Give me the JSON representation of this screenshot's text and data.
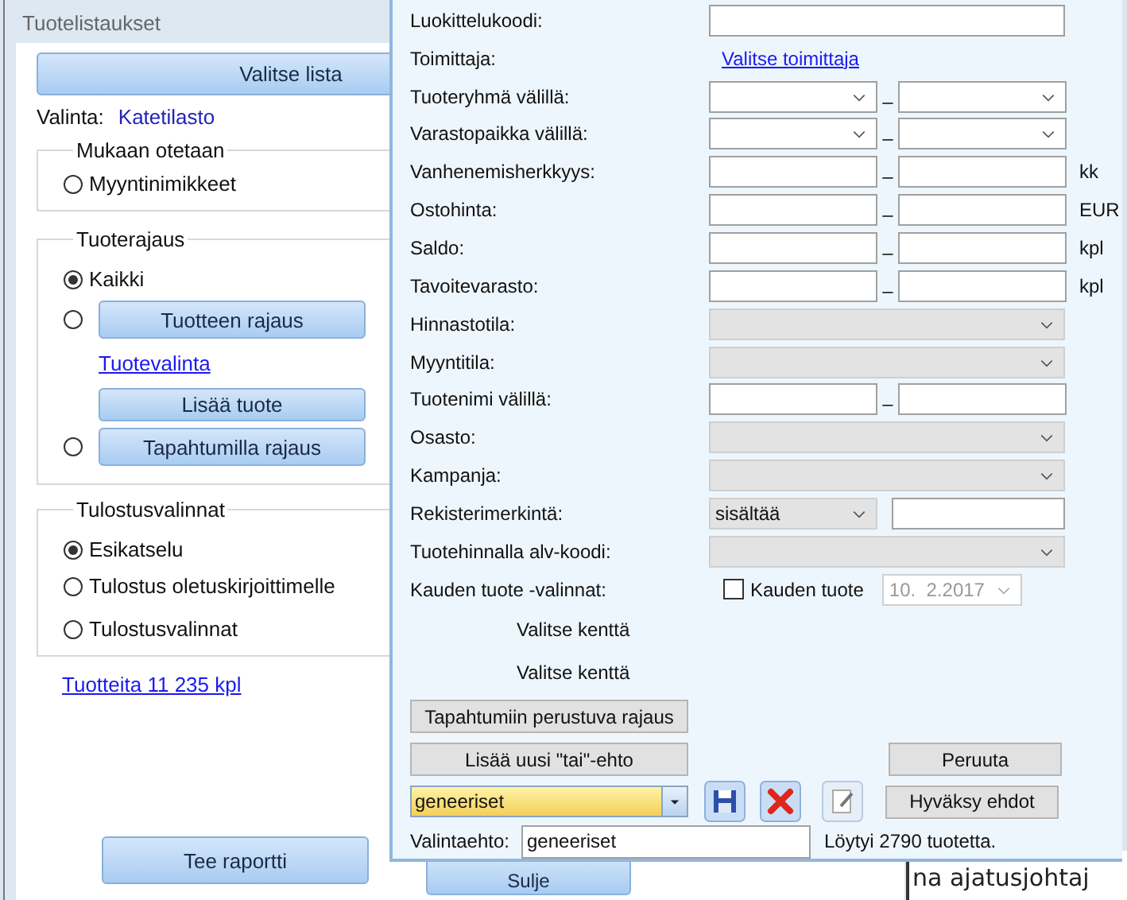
{
  "left_window": {
    "title": "Tuotelistaukset",
    "choose_list_button": "Valitse lista",
    "selection_label": "Valinta:",
    "selection_value": "Katetilasto",
    "groups": [
      {
        "title": "Mukaan otetaan",
        "items": [
          {
            "kind": "radio",
            "label": "Myyntinimikkeet",
            "selected": false
          }
        ]
      },
      {
        "title": "Tuoterajaus",
        "items": [
          {
            "kind": "radio",
            "label": "Kaikki",
            "selected": true
          },
          {
            "kind": "radio_button",
            "label": "Tuotteen rajaus",
            "selected": false
          },
          {
            "kind": "link",
            "label": "Tuotevalinta"
          },
          {
            "kind": "button",
            "label": "Lisää tuote"
          },
          {
            "kind": "radio_button",
            "label": "Tapahtumilla rajaus",
            "selected": false
          }
        ]
      },
      {
        "title": "Tulostusvalinnat",
        "items": [
          {
            "kind": "radio",
            "label": "Esikatselu",
            "selected": true
          },
          {
            "kind": "radio",
            "label": "Tulostus oletuskirjoittimelle",
            "selected": false
          },
          {
            "kind": "radio",
            "label": "Tulostusvalinnat",
            "selected": false
          }
        ]
      }
    ],
    "count_link": "Tuotteita 11 235 kpl",
    "report_button": "Tee raportti",
    "close_button": "Sulje"
  },
  "background_text": "na ajatusjohtaj",
  "dialog": {
    "rows": [
      {
        "label": "Luokittelukoodi:",
        "kind": "text"
      },
      {
        "label": "Toimittaja:",
        "kind": "link",
        "link": "Valitse toimittaja"
      },
      {
        "label": "Tuoteryhmä välillä:",
        "kind": "combo_range",
        "separator": "–"
      },
      {
        "label": "Varastopaikka välillä:",
        "kind": "combo_range",
        "separator": "–"
      },
      {
        "label": "Vanhenemisherkkyys:",
        "kind": "text_range",
        "separator": "–",
        "unit": "kk"
      },
      {
        "label": "Ostohinta:",
        "kind": "text_range",
        "separator": "–",
        "unit": "EUR"
      },
      {
        "label": "Saldo:",
        "kind": "text_range",
        "separator": "–",
        "unit": "kpl"
      },
      {
        "label": "Tavoitevarasto:",
        "kind": "text_range",
        "separator": "–",
        "unit": "kpl"
      },
      {
        "label": "Hinnastotila:",
        "kind": "disabled_combo"
      },
      {
        "label": "Myyntitila:",
        "kind": "disabled_combo"
      },
      {
        "label": "Tuotenimi välillä:",
        "kind": "text_range",
        "separator": "–"
      },
      {
        "label": "Osasto:",
        "kind": "disabled_combo"
      },
      {
        "label": "Kampanja:",
        "kind": "disabled_combo"
      },
      {
        "label": "Rekisterimerkintä:",
        "kind": "operator",
        "value": "sisältää"
      },
      {
        "label": "Tuotehinnalla alv-koodi:",
        "kind": "disabled_combo"
      },
      {
        "label": "Kauden tuote -valinnat:",
        "kind": "checkbox",
        "checkbox_label": "Kauden tuote",
        "checked": false,
        "date": "10.  2.2017"
      }
    ],
    "field_prompts": [
      "Valitse kenttä",
      "Valitse kenttä"
    ],
    "event_button": "Tapahtumiin perustuva rajaus",
    "add_or_button": "Lisää uusi \"tai\"-ehto",
    "cancel_button": "Peruuta",
    "accept_button": "Hyväksy ehdot",
    "saved_filter": "geneeriset",
    "criterion_label": "Valintaehto:",
    "criterion_value": "geneeriset",
    "result": "Löytyi 2790 tuotetta."
  }
}
